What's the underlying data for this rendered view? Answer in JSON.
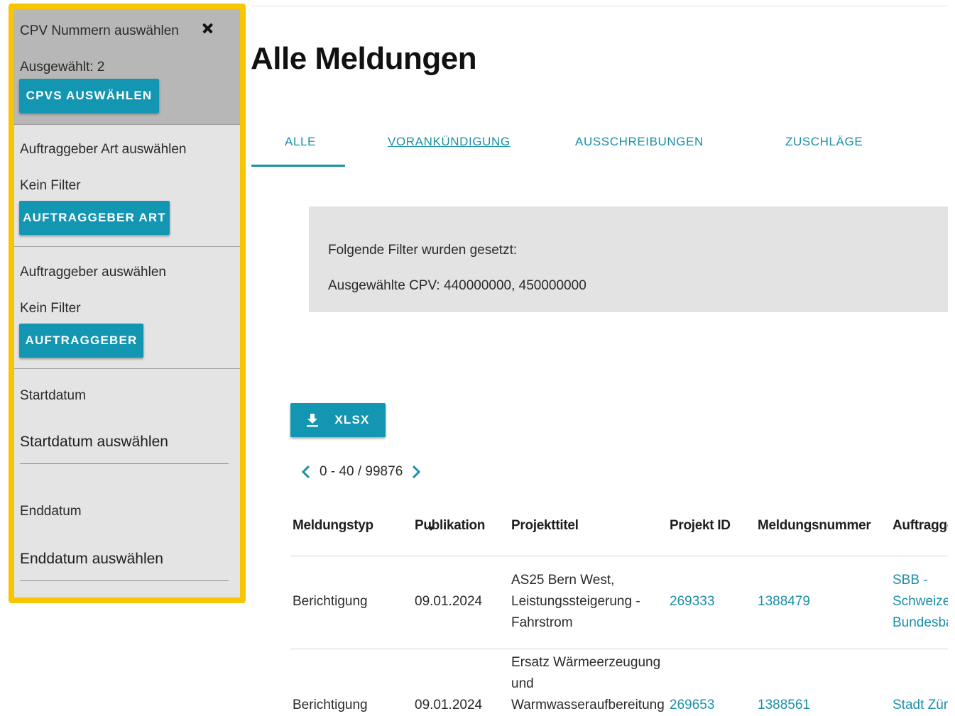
{
  "filter_panel": {
    "cpv": {
      "title": "CPV Nummern auswählen",
      "selected_text": "Ausgewählt: 2",
      "button_label": "CPVS AUSWÄHLEN"
    },
    "auftraggeber_art": {
      "title": "Auftraggeber Art auswählen",
      "status": "Kein Filter",
      "button_label": "AUFTRAGGEBER ART"
    },
    "auftraggeber": {
      "title": "Auftraggeber auswählen",
      "status": "Kein Filter",
      "button_label": "AUFTRAGGEBER"
    },
    "startdatum": {
      "label": "Startdatum",
      "value": "Startdatum auswählen"
    },
    "enddatum": {
      "label": "Enddatum",
      "value": "Enddatum auswählen"
    },
    "highlight_color": "#f7c600"
  },
  "main": {
    "title": "Alle Meldungen",
    "tabs": [
      {
        "label": "ALLE",
        "active": true
      },
      {
        "label": "VORANKÜNDIGUNG",
        "active": false
      },
      {
        "label": "AUSSCHREIBUNGEN",
        "active": false
      },
      {
        "label": "ZUSCHLÄGE",
        "active": false
      }
    ],
    "filter_info": {
      "heading": "Folgende Filter wurden gesetzt:",
      "cpv_line": "Ausgewählte CPV: 440000000, 450000000"
    },
    "export_button": {
      "label": "XLSX",
      "icon": "download-icon"
    },
    "pagination": {
      "text": "0 - 40 / 99876"
    },
    "table": {
      "columns": [
        "Meldungstyp",
        "Publikation",
        "Projekttitel",
        "Projekt ID",
        "Meldungsnummer",
        "Auftragge"
      ],
      "rows": [
        {
          "meldungstyp": "Berichtigung",
          "publikation": "09.01.2024",
          "projekttitel": [
            "AS25 Bern West,",
            "Leistungssteigerung -",
            "Fahrstrom"
          ],
          "projekt_id": "269333",
          "meldungsnummer": "1388479",
          "auftraggeber": [
            "SBB -",
            "Schweizer",
            "Bundesba"
          ]
        },
        {
          "meldungstyp": "Berichtigung",
          "publikation": "09.01.2024",
          "projekttitel": [
            "Ersatz Wärmeerzeugung",
            "und",
            "Warmwasseraufbereitung"
          ],
          "projekt_id": "269653",
          "meldungsnummer": "1388561",
          "auftraggeber": [
            "Stadt Züri"
          ]
        }
      ]
    },
    "accent_color": "#1296b1"
  }
}
